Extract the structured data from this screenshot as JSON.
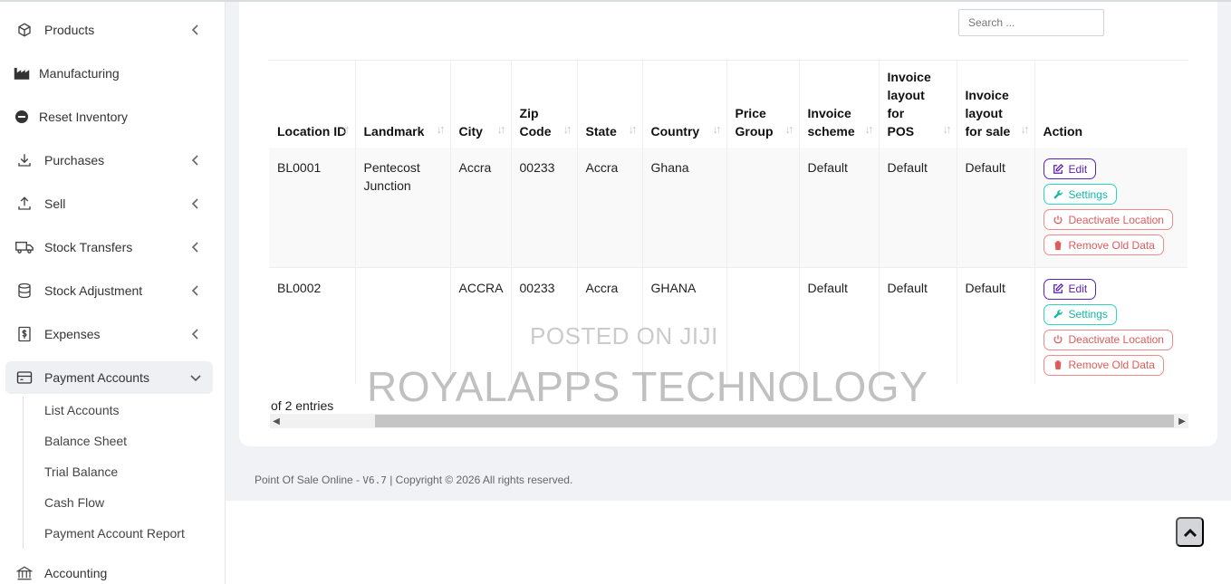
{
  "sidebar": {
    "items": [
      {
        "label": "Products",
        "icon": "cube-icon"
      },
      {
        "label": "Manufacturing",
        "icon": "factory-icon"
      },
      {
        "label": "Reset Inventory",
        "icon": "minus-circle-icon"
      },
      {
        "label": "Purchases",
        "icon": "arrow-down-icon"
      },
      {
        "label": "Sell",
        "icon": "arrow-up-icon"
      },
      {
        "label": "Stock Transfers",
        "icon": "truck-icon"
      },
      {
        "label": "Stock Adjustment",
        "icon": "database-icon"
      },
      {
        "label": "Expenses",
        "icon": "dollar-receipt-icon"
      },
      {
        "label": "Payment Accounts",
        "icon": "credit-card-icon"
      },
      {
        "label": "Accounting",
        "icon": "bank-icon"
      }
    ],
    "sub_items": [
      "List Accounts",
      "Balance Sheet",
      "Trial Balance",
      "Cash Flow",
      "Payment Account Report"
    ]
  },
  "search": {
    "placeholder": "Search ..."
  },
  "table": {
    "headers": [
      "Location ID",
      "Landmark",
      "City",
      "Zip Code",
      "State",
      "Country",
      "Price Group",
      "Invoice scheme",
      "Invoice layout for POS",
      "Invoice layout for sale",
      "Action"
    ],
    "rows": [
      {
        "location_id": "BL0001",
        "landmark": "Pentecost Junction",
        "city": "Accra",
        "zip": "00233",
        "state": "Accra",
        "country": "Ghana",
        "price_group": "",
        "invoice_scheme": "Default",
        "layout_pos": "Default",
        "layout_sale": "Default"
      },
      {
        "location_id": "BL0002",
        "landmark": "",
        "city": "ACCRA",
        "zip": "00233",
        "state": "Accra",
        "country": "GHANA",
        "price_group": "",
        "invoice_scheme": "Default",
        "layout_pos": "Default",
        "layout_sale": "Default"
      }
    ],
    "actions": {
      "edit": "Edit",
      "settings": "Settings",
      "deactivate": "Deactivate Location",
      "remove": "Remove Old Data"
    }
  },
  "entries_text": "of 2 entries",
  "footer": {
    "prefix": "Point Of Sale Online - ",
    "version": "V6.7",
    "suffix": " | Copyright © 2026 All rights reserved."
  },
  "watermark": {
    "line1": "POSTED ON JIJI",
    "line2": "ROYALAPPS TECHNOLOGY"
  }
}
